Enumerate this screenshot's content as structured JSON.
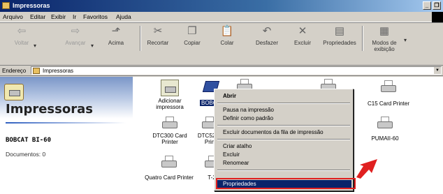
{
  "window": {
    "title": "Impressoras",
    "controls": [
      "_",
      "\u0001"
    ]
  },
  "menu": [
    {
      "label": "Arquivo",
      "u": "A"
    },
    {
      "label": "Editar",
      "u": "d"
    },
    {
      "label": "Exibir",
      "u": "x"
    },
    {
      "label": "Ir",
      "u": "I"
    },
    {
      "label": "Favoritos",
      "u": "F"
    },
    {
      "label": "Ajuda",
      "u": "j"
    }
  ],
  "toolbar": {
    "back": "Voltar",
    "forward": "Avançar",
    "up": "Acima",
    "cut": "Recortar",
    "copy": "Copiar",
    "paste": "Colar",
    "undo": "Desfazer",
    "delete": "Excluir",
    "properties": "Propriedades",
    "views": "Modos de exibição",
    "views_line1": "Modos de",
    "views_line2": "exibição"
  },
  "address": {
    "label": "Endereço",
    "value": "Impressoras"
  },
  "leftpane": {
    "title": "Impressoras",
    "selected_printer": "BOBCAT BI-60",
    "documents": "Documentos: 0"
  },
  "printers": {
    "add": [
      "Adicionar",
      "impressora"
    ],
    "bobcat": "BOBCA",
    "dtc300": [
      "DTC300 Card",
      "Printer"
    ],
    "dtc520": [
      "DTC520_",
      "Prin"
    ],
    "c15": "C15 Card Printer",
    "pumaii": "PUMAII-60",
    "quatro": "Quatro Card Printer",
    "t2": "T-2"
  },
  "context_menu": {
    "open": "Abrir",
    "pause": "Pausa na impressão",
    "default": "Definir como padrão",
    "purge": "Excluir documentos da fila de impressão",
    "shortcut": "Criar atalho",
    "delete": "Excluir",
    "rename": "Renomear",
    "properties": "Propriedades"
  },
  "colors": {
    "highlight": "#0a246a",
    "annotation": "#e02020"
  }
}
